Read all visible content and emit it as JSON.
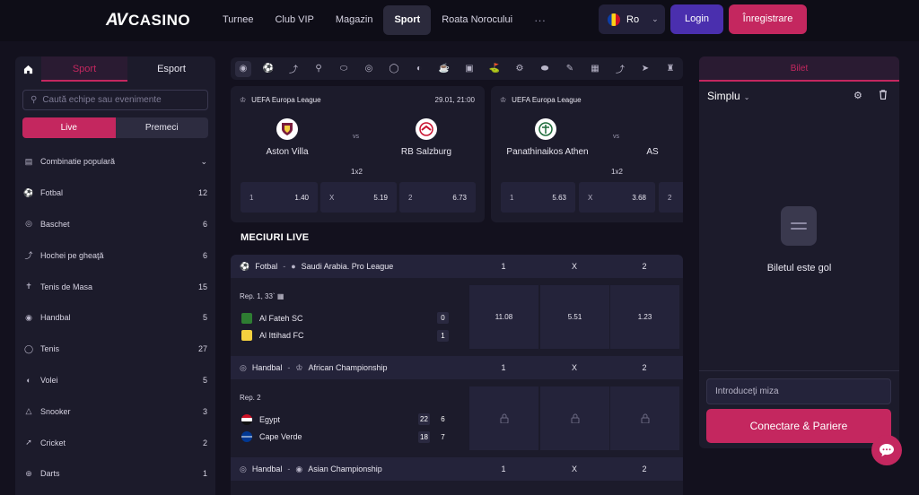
{
  "header": {
    "logo_mark": "AV",
    "logo_text": "CASINO",
    "nav": [
      "Turnee",
      "Club VIP",
      "Magazin",
      "Sport",
      "Roata Norocului"
    ],
    "active_nav": "Sport",
    "more": "···",
    "lang": "Ro",
    "login": "Login",
    "register": "Înregistrare"
  },
  "sidebar": {
    "tab_sport": "Sport",
    "tab_esport": "Esport",
    "search_placeholder": "Caută echipe sau evenimente",
    "toggle_live": "Live",
    "toggle_prematch": "Premeci",
    "items": [
      {
        "label": "Combinatie populară",
        "count": "",
        "icon": "chart-icon"
      },
      {
        "label": "Fotbal",
        "count": "12",
        "icon": "soccer-icon"
      },
      {
        "label": "Baschet",
        "count": "6",
        "icon": "basketball-icon"
      },
      {
        "label": "Hochei pe gheaţă",
        "count": "6",
        "icon": "hockey-icon"
      },
      {
        "label": "Tenis de Masa",
        "count": "15",
        "icon": "table-tennis-icon"
      },
      {
        "label": "Handbal",
        "count": "5",
        "icon": "handball-icon"
      },
      {
        "label": "Tenis",
        "count": "27",
        "icon": "tennis-icon"
      },
      {
        "label": "Volei",
        "count": "5",
        "icon": "volleyball-icon"
      },
      {
        "label": "Snooker",
        "count": "3",
        "icon": "snooker-icon"
      },
      {
        "label": "Cricket",
        "count": "2",
        "icon": "cricket-icon"
      },
      {
        "label": "Darts",
        "count": "1",
        "icon": "darts-icon"
      }
    ]
  },
  "featured": [
    {
      "league": "UEFA Europa League",
      "date": "29.01, 21:00",
      "home": "Aston Villa",
      "away": "RB Salzburg",
      "vs": "vs",
      "market": "1x2",
      "odds": [
        {
          "label": "1",
          "value": "1.40"
        },
        {
          "label": "X",
          "value": "5.19"
        },
        {
          "label": "2",
          "value": "6.73"
        }
      ]
    },
    {
      "league": "UEFA Europa League",
      "date": "",
      "home": "Panathinaikos Athen",
      "away": "AS",
      "vs": "vs",
      "market": "1x2",
      "odds": [
        {
          "label": "1",
          "value": "5.63"
        },
        {
          "label": "X",
          "value": "3.68"
        },
        {
          "label": "2",
          "value": ""
        }
      ]
    }
  ],
  "live": {
    "title": "MECIURI LIVE",
    "columns": [
      "1",
      "X",
      "2"
    ],
    "groups": [
      {
        "sport": "Fotbal",
        "league": "Saudi Arabia. Pro League",
        "info": "Rep. 1, 33`",
        "home": "Al Fateh SC",
        "away": "Al Ittihad FC",
        "home_score": "0",
        "away_score": "1",
        "home_score2": "",
        "away_score2": "",
        "odds": [
          "11.08",
          "5.51",
          "1.23"
        ]
      },
      {
        "sport": "Handbal",
        "league": "African Championship",
        "info": "Rep. 2",
        "home": "Egypt",
        "away": "Cape Verde",
        "home_score": "22",
        "away_score": "18",
        "home_score2": "6",
        "away_score2": "7",
        "odds": [
          "🔒",
          "🔒",
          "🔒"
        ]
      },
      {
        "sport": "Handbal",
        "league": "Asian Championship"
      }
    ]
  },
  "betslip": {
    "title": "Bilet",
    "mode": "Simplu",
    "empty": "Biletul este gol",
    "stake_placeholder": "Introduceţi miza",
    "connect": "Conectare & Pariere"
  },
  "colors": {
    "accent": "#c4275f",
    "login": "#4a2fae",
    "bg": "#13111e",
    "panel": "#1c1b2b"
  }
}
